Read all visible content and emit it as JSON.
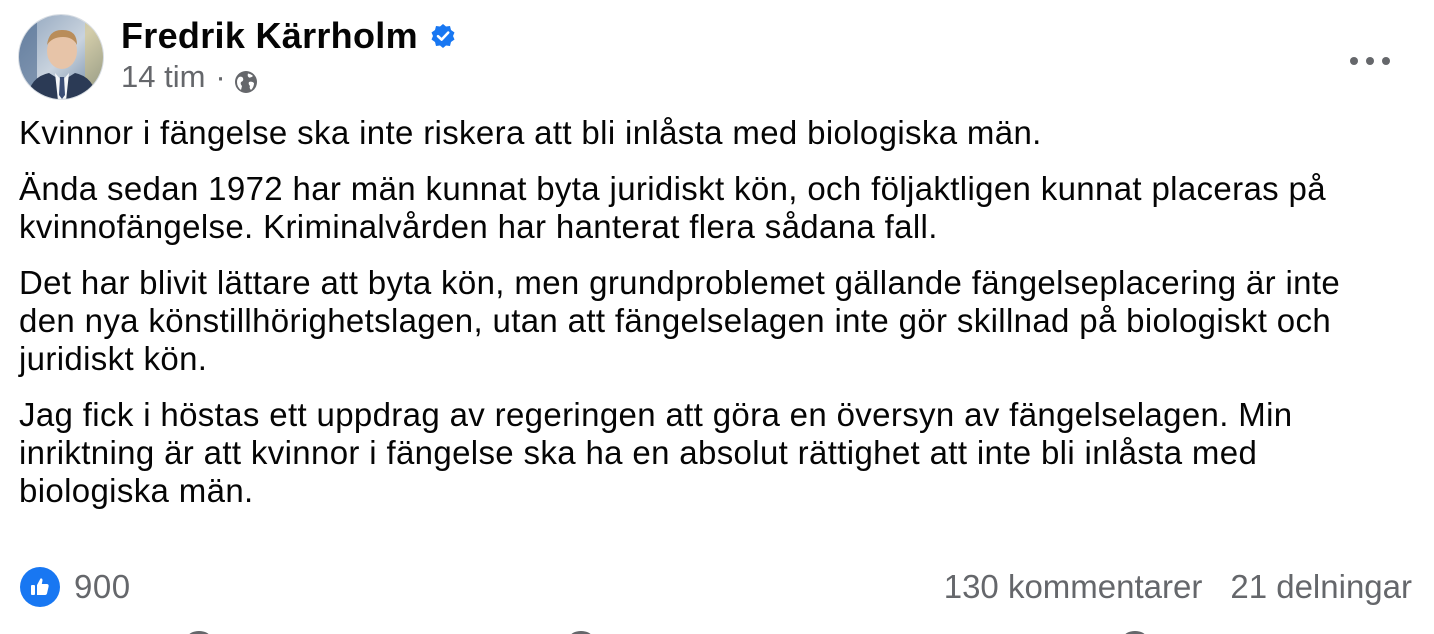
{
  "post": {
    "author": {
      "name": "Fredrik Kärrholm",
      "verified": true,
      "avatar_icon": "profile-photo"
    },
    "timestamp": "14 tim",
    "separator": "·",
    "audience_icon": "globe-icon",
    "more_icon": "more-options-icon",
    "paragraphs": [
      "Kvinnor i fängelse ska inte riskera att bli inlåsta med biologiska män.",
      "Ända sedan 1972 har män kunnat byta juridiskt kön, och följaktligen kunnat placeras på kvinnofängelse. Kriminalvården har hanterat flera sådana fall.",
      "Det har blivit lättare att byta kön, men grundproblemet gällande fängelseplacering är inte den nya könstillhörighetslagen, utan att fängelselagen inte gör skillnad på biologiskt och juridiskt kön.",
      "Jag fick i höstas ett uppdrag av regeringen att göra en översyn av fängelselagen. Min inriktning är att kvinnor i fängelse ska ha en absolut rättighet att inte bli inlåsta med biologiska män."
    ],
    "reactions": {
      "like_count": "900",
      "comments": "130 kommentarer",
      "shares": "21 delningar"
    },
    "colors": {
      "accent": "#1877f2",
      "secondary_text": "#65676b",
      "primary_text": "#050505"
    }
  }
}
